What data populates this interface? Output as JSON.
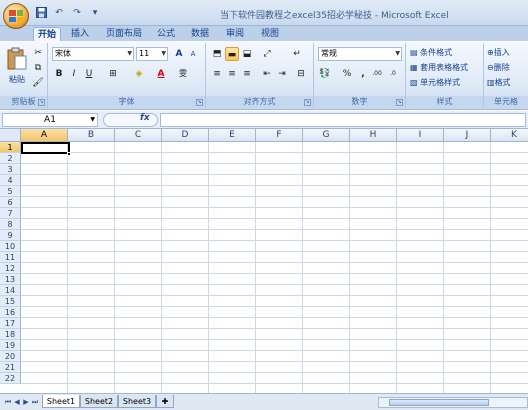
{
  "window": {
    "title": "当下软件园教程之excel35招必学秘技 - Microsoft Excel"
  },
  "qat": {
    "save_icon": "save-icon",
    "undo_label": "↶",
    "redo_label": "↷",
    "customize_label": "▾"
  },
  "tabs": [
    "开始",
    "插入",
    "页面布局",
    "公式",
    "数据",
    "审阅",
    "视图"
  ],
  "ribbon": {
    "clipboard": {
      "label": "剪贴板",
      "paste_label": "粘贴"
    },
    "font": {
      "label": "字体",
      "font_name": "宋体",
      "font_size": "11",
      "grow": "A",
      "shrink": "A",
      "bold": "B",
      "italic": "I",
      "underline": "U",
      "font_color": "A",
      "phonetic": "雯"
    },
    "alignment": {
      "label": "对齐方式"
    },
    "number": {
      "label": "数字",
      "format": "常规",
      "percent": "%",
      "comma": ",",
      "inc_dec": ".00",
      "dec_dec": ".0"
    },
    "styles": {
      "label": "样式",
      "conditional": "条件格式",
      "table_format": "套用表格格式",
      "cell_styles": "单元格样式"
    },
    "cells": {
      "label": "单元格",
      "insert": "插入",
      "delete": "删除",
      "format": "格式"
    }
  },
  "formula_bar": {
    "name_box": "A1",
    "fx_label": "fx",
    "value": ""
  },
  "columns": [
    "A",
    "B",
    "C",
    "D",
    "E",
    "F",
    "G",
    "H",
    "I",
    "J",
    "K"
  ],
  "rows": [
    "1",
    "2",
    "3",
    "4",
    "5",
    "6",
    "7",
    "8",
    "9",
    "10",
    "11",
    "12",
    "13",
    "14",
    "15",
    "16",
    "17",
    "18",
    "19",
    "20",
    "21",
    "22"
  ],
  "sheets": [
    "Sheet1",
    "Sheet2",
    "Sheet3"
  ],
  "colors": {
    "accent": "#f6c46a",
    "tab_bg": "#bcd0ea"
  }
}
